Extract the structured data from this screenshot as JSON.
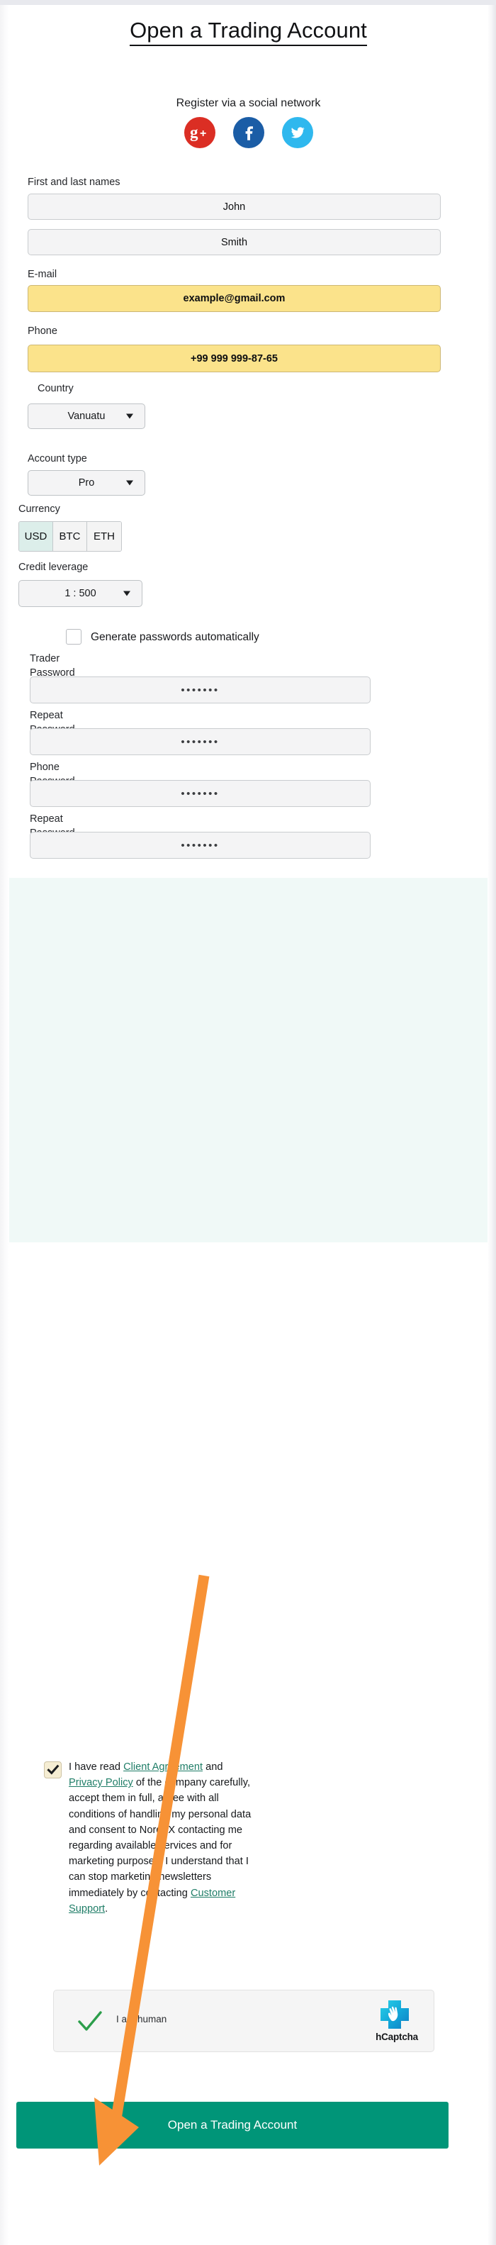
{
  "page": {
    "title": "Open a Trading Account"
  },
  "social": {
    "heading": "Register via a social network",
    "buttons": [
      {
        "name": "google-plus",
        "label": "G+",
        "color": "#db2e24"
      },
      {
        "name": "facebook",
        "label": "f",
        "color": "#1b5da6"
      },
      {
        "name": "twitter",
        "label": "bird",
        "color": "#2fb8ee"
      }
    ]
  },
  "form": {
    "names_label": "First and last names",
    "first_name": "John",
    "last_name": "Smith",
    "email_label": "E-mail",
    "email_value": "example@gmail.com",
    "phone_label": "Phone",
    "phone_value": "+99 999 999-87-65",
    "country_label": "Country",
    "country_value": "Vanuatu",
    "account_type_label": "Account type",
    "account_type_value": "Pro",
    "currency_label": "Currency",
    "currency_options": [
      "USD",
      "BTC",
      "ETH"
    ],
    "currency_selected": "USD",
    "leverage_label": "Credit leverage",
    "leverage_value": "1 : 500",
    "generate_passwords_label": "Generate passwords automatically",
    "generate_passwords_checked": false,
    "trader_password_label": "Trader\nPassword",
    "trader_password_value": "•••••••",
    "trader_repeat_label": "Repeat\nPassword",
    "trader_repeat_value": "•••••••",
    "phone_password_label": "Phone\nPassword",
    "phone_password_value": "•••••••",
    "phone_repeat_label": "Repeat\nPassword",
    "phone_repeat_value": "•••••••"
  },
  "agreement": {
    "checked": true,
    "part1": "I have read ",
    "link1": "Client Agreement",
    "part2": " and ",
    "link2": "Privacy Policy",
    "part3": " of the company carefully, accept them in full, agree with all conditions of handling my personal data and consent to NordFX contacting me regarding available services and for marketing purposes. I understand that I can stop marketing newsletters immediately by contacting ",
    "link3": "Customer Support",
    "part4": "."
  },
  "captcha": {
    "label": "I am human",
    "brand": "hCaptcha",
    "checkmark_color": "#2c9e4b"
  },
  "submit": {
    "label": "Open a Trading Account",
    "color": "#009578"
  },
  "annotation": {
    "arrow_color": "#f79236"
  },
  "colors": {
    "accent": "#009578",
    "link": "#1f7d67",
    "highlight_field": "#fbe38b",
    "mint_section": "#f0f9f7"
  }
}
